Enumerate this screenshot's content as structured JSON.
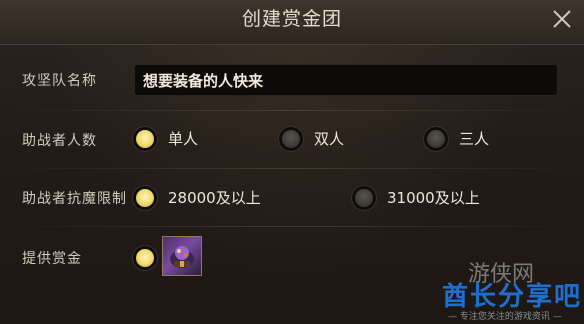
{
  "dialog": {
    "title": "创建赏金团"
  },
  "form": {
    "team_name": {
      "label": "攻坚队名称",
      "value": "想要装备的人快来"
    },
    "helper_count": {
      "label": "助战者人数",
      "options": [
        {
          "label": "单人",
          "selected": true
        },
        {
          "label": "双人",
          "selected": false
        },
        {
          "label": "三人",
          "selected": false
        }
      ]
    },
    "resistance_limit": {
      "label": "助战者抗魔限制",
      "options": [
        {
          "label": "28000及以上",
          "selected": true
        },
        {
          "label": "31000及以上",
          "selected": false
        }
      ]
    },
    "bounty": {
      "label": "提供赏金",
      "selected": true,
      "item_icon": "purple-treasure-item-icon"
    }
  },
  "watermark": {
    "main": "酋长分享吧",
    "sub": "— 专注您关注的游戏资讯 —",
    "logo_text": "游侠网"
  },
  "colors": {
    "radio_on": "#f1d86a",
    "radio_off": "#3a3632",
    "watermark_blue": "#1f6fd1"
  }
}
